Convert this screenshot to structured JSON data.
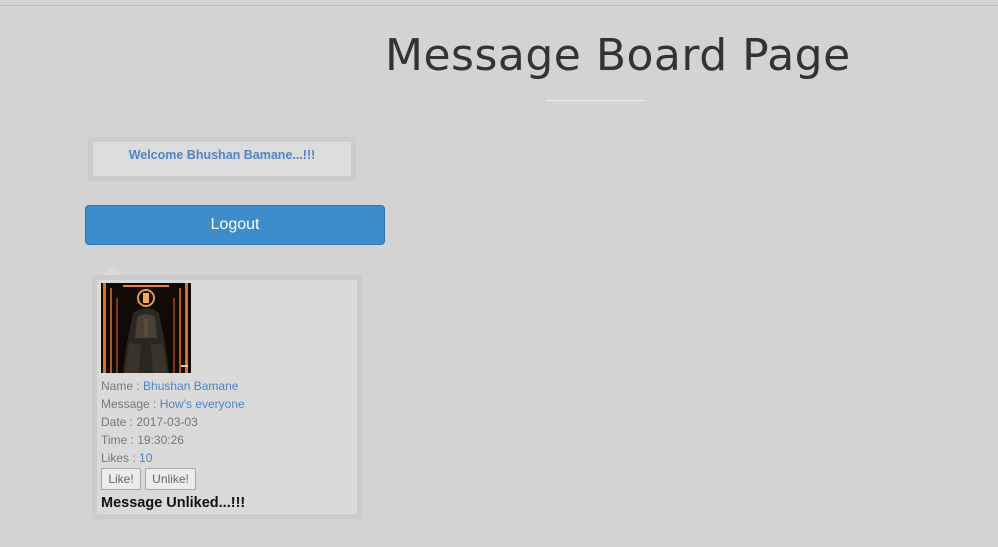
{
  "page": {
    "title": "Message Board Page"
  },
  "welcome": {
    "text": "Welcome Bhushan Bamane...!!!"
  },
  "logout": {
    "label": "Logout"
  },
  "post": {
    "name_label": "Name : ",
    "name": "Bhushan Bamane",
    "message_label": "Message : ",
    "message": "How's everyone",
    "date_label": "Date : ",
    "date": "2017-03-03",
    "time_label": "Time : ",
    "time": "19:30:26",
    "likes_label": "Likes : ",
    "likes": "10",
    "like_button": "Like!",
    "unlike_button": "Unlike!",
    "status": "Message Unliked...!!!"
  },
  "colors": {
    "background": "#d3d3d3",
    "accent": "#3d8ccc",
    "link": "#4a86c8"
  }
}
